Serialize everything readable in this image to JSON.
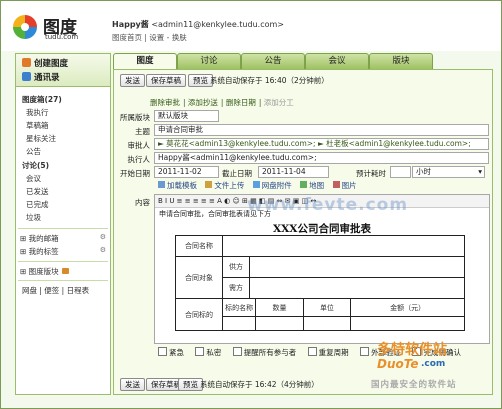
{
  "brand": {
    "name": "图度",
    "domain": "tudu.com"
  },
  "user": {
    "name": "Happy酱",
    "email": "<admin11@kenkylee.tudu.com>",
    "links": "图度首页 | 设置 - 换肤"
  },
  "tabs": [
    "图度",
    "讨论",
    "公告",
    "会议",
    "版块"
  ],
  "sidebar": {
    "create": "创建图度",
    "contacts": "通讯录",
    "tudu_box": "图度箱(27)",
    "tudu_items": [
      "我执行",
      "草稿箱",
      "星标关注",
      "公告"
    ],
    "discuss": "讨论(5)",
    "discuss_items": [
      "会议",
      "已发送",
      "已完成",
      "垃圾"
    ],
    "groups": [
      "我的邮箱",
      "我的标签"
    ],
    "board": "图度版块",
    "bottom_links": "网盘 | 便签 | 日程表"
  },
  "toolbar": {
    "send": "发送",
    "save_draft": "保存草稿",
    "preview": "预览",
    "autosave_top": "系统自动保存于 16:40（2分钟前）",
    "autosave_bottom": "系统自动保存于 16:42（4分钟前）"
  },
  "actions": {
    "delete_review": "删除审批",
    "add_cc": "添加抄送",
    "delete_date": "删除日期",
    "add_subtask": "添加分工"
  },
  "form": {
    "board_label": "所属版块",
    "board_value": "默认版块",
    "subject_label": "主题",
    "subject_value": "申请合同审批",
    "reviewer_label": "审批人",
    "reviewer_value": "► 莫花花<admin13@kenkylee.tudu.com>; ► 杜老板<admin1@kenkylee.tudu.com>;",
    "executor_label": "执行人",
    "executor_value": "Happy酱<admin11@kenkylee.tudu.com>;",
    "start_label": "开始日期",
    "start_value": "2011-11-02",
    "end_label": "截止日期",
    "end_value": "2011-11-04",
    "estimate_label": "预计耗时",
    "estimate_unit": "小时",
    "content_label": "内容"
  },
  "attach": [
    "加载模板",
    "文件上传",
    "网盘附件",
    "地图",
    "图片"
  ],
  "editor": {
    "tools": "B I U ≡ ≡ ≡ ≡ ≡ A ◐ ☺ ⊞ ▦ ◧ ▤ ⇔ ✉ ▣ ◫ ↔",
    "hint": "申请合同审批，合同审批表请见下方",
    "doc_title": "XXX公司合同审批表",
    "row_contract_name": "合同名称",
    "row_contract_party": "合同对象",
    "party_a": "供方",
    "party_b": "需方",
    "row_target": "合同标的",
    "col_name": "标的名称",
    "col_qty": "数量",
    "col_unit": "单位",
    "col_amount": "金额（元）"
  },
  "options": [
    {
      "label": "紧急",
      "checked": false
    },
    {
      "label": "私密",
      "checked": false
    },
    {
      "label": "提醒所有参与者",
      "checked": false
    },
    {
      "label": "重复周期",
      "checked": false
    },
    {
      "label": "外部验证",
      "checked": false
    },
    {
      "label": "完成需确认",
      "checked": true
    }
  ],
  "watermarks": {
    "center": "www.fevte.com",
    "site1": "多特软件站",
    "site1_tag": "软件站",
    "site2": "DuoTe",
    "site2_tag": ".com",
    "slogan": "国内最安全的软件站"
  },
  "colors": {
    "tab_green": "#9fc164",
    "panel_bg": "#f6fbea",
    "border": "#9bbd6a"
  }
}
